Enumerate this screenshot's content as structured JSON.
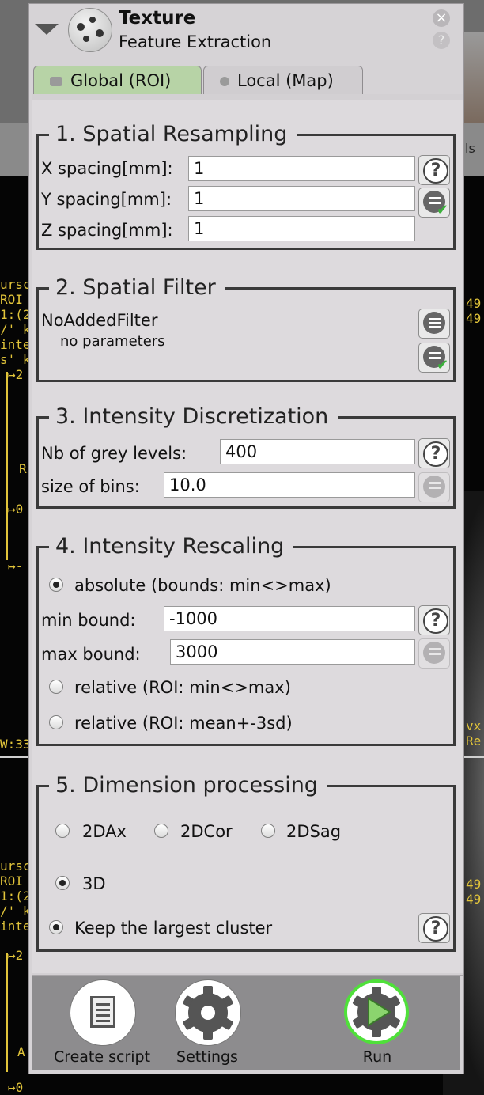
{
  "window": {
    "title": "Texture",
    "subtitle": "Feature Extraction",
    "close_symbol": "×",
    "help_symbol": "?"
  },
  "tabs": [
    {
      "label": "Global (ROI)",
      "active": true
    },
    {
      "label": "Local (Map)",
      "active": false
    }
  ],
  "background_text": {
    "right_top": "ls",
    "left_1": "ursc\nROI #\n1:(2\n/' ke\ninte\ns' ke",
    "left_arrow_1": "↦2",
    "left_r1": "R",
    "left_zero_1": "↦0",
    "left_dash_1": "↦-",
    "right_1": "49\n49",
    "left_w": "W:33",
    "right_vx": "vx\nRe",
    "left_2": "ursc\nROI #\n1:(2\n/' ke\ninte",
    "left_arrow_2": "↦2",
    "right_2": "49\n49",
    "left_a": "A",
    "left_zero_2": "↦0"
  },
  "section1": {
    "title": "1. Spatial Resampling",
    "x_label": "X spacing[mm]:",
    "x_value": "1",
    "y_label": "Y spacing[mm]:",
    "y_value": "1",
    "z_label": "Z spacing[mm]:",
    "z_value": "1"
  },
  "section2": {
    "title": "2. Spatial Filter",
    "filter_name": "NoAddedFilter",
    "filter_params": "no parameters"
  },
  "section3": {
    "title": "3. Intensity Discretization",
    "grey_label": "Nb of grey levels:",
    "grey_value": "400",
    "bins_label": "size of bins:",
    "bins_value": "10.0"
  },
  "section4": {
    "title": "4. Intensity Rescaling",
    "absolute_label": "absolute (bounds: min<>max)",
    "min_label": "min bound:",
    "min_value": "-1000",
    "max_label": "max bound:",
    "max_value": "3000",
    "relative1_label": "relative (ROI: min<>max)",
    "relative2_label": "relative (ROI: mean+-3sd)",
    "selected": "absolute"
  },
  "section5": {
    "title": "5. Dimension processing",
    "opt_2dax": "2DAx",
    "opt_2dcor": "2DCor",
    "opt_2dsag": "2DSag",
    "opt_3d": "3D",
    "selected": "3D",
    "keep_largest_label": "Keep the largest cluster",
    "keep_largest": true
  },
  "bottom": {
    "create_script": "Create script",
    "settings": "Settings",
    "run": "Run"
  },
  "colors": {
    "tab_active": "#b7d3a6",
    "run_ring": "#4fe03a",
    "check_green": "#3bb13b"
  }
}
